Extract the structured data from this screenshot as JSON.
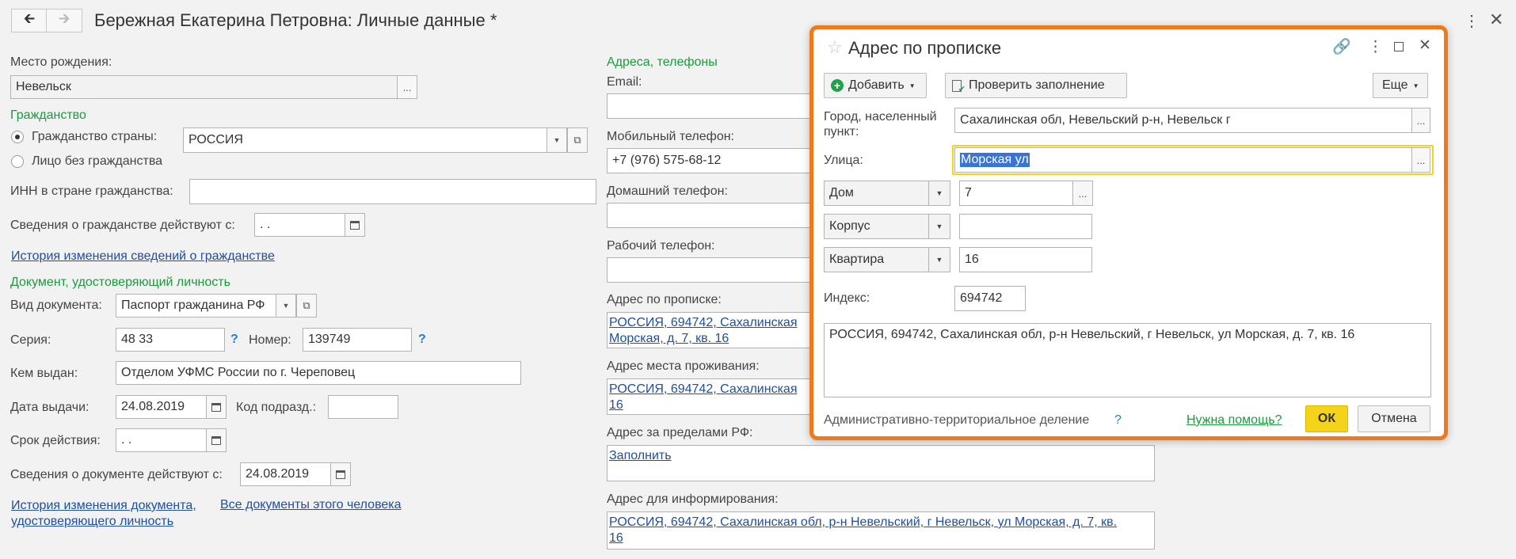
{
  "header": {
    "back_icon": "arrow-left-icon",
    "forward_icon": "arrow-right-icon",
    "title": "Бережная Екатерина Петровна: Личные данные *",
    "more_icon": "vertical-dots-icon",
    "close_icon": "close-icon"
  },
  "left": {
    "birthplace_label": "Место рождения:",
    "birthplace_value": "Невельск",
    "citizenship_section": "Гражданство",
    "radio_country_label": "Гражданство страны:",
    "country_value": "РОССИЯ",
    "radio_stateless_label": "Лицо без гражданства",
    "inn_label": "ИНН в стране гражданства:",
    "inn_value": "",
    "citizenship_valid_label": "Сведения о гражданстве действуют с:",
    "citizenship_valid_value": " .  .",
    "citizenship_history_link": "История изменения сведений о гражданстве",
    "doc_section": "Документ, удостоверяющий личность",
    "doc_type_label": "Вид документа:",
    "doc_type_value": "Паспорт гражданина РФ",
    "series_label": "Серия:",
    "series_value": "48 33",
    "number_label": "Номер:",
    "number_value": "139749",
    "issued_by_label": "Кем выдан:",
    "issued_by_value": "Отделом УФМС России по г. Череповец",
    "issue_date_label": "Дата выдачи:",
    "issue_date_value": "24.08.2019",
    "dept_code_label": "Код подразд.:",
    "dept_code_value": "",
    "expiry_label": "Срок действия:",
    "expiry_value": " .  .",
    "doc_valid_label": "Сведения о документе действуют с:",
    "doc_valid_value": "24.08.2019",
    "doc_history_link_line1": "История изменения документа,",
    "doc_history_link_line2": "удостоверяющего личность",
    "all_docs_link": "Все документы этого человека"
  },
  "right": {
    "section": "Адреса, телефоны",
    "email_label": "Email:",
    "mobile_label": "Мобильный телефон:",
    "mobile_value": "+7 (976) 575-68-12",
    "home_label": "Домашний телефон:",
    "work_label": "Рабочий телефон:",
    "reg_addr_label": "Адрес по прописке:",
    "reg_addr_line1": "РОССИЯ, 694742, Сахалинская",
    "reg_addr_line2": "Морская, д. 7, кв. 16",
    "res_addr_label": "Адрес места проживания:",
    "res_addr_line1": "РОССИЯ, 694742, Сахалинская",
    "res_addr_line2": "16",
    "foreign_addr_label": "Адрес за пределами РФ:",
    "foreign_addr_link": "Заполнить",
    "info_addr_label": "Адрес для информирования:",
    "info_addr_line1": "РОССИЯ, 694742, Сахалинская обл, р-н Невельский, г Невельск, ул Морская, д. 7, кв.",
    "info_addr_line2": "16"
  },
  "dialog": {
    "star_icon": "star-icon",
    "title": "Адрес по прописке",
    "link_icon": "link-icon",
    "more_icon": "vertical-dots-icon",
    "maximize_icon": "maximize-icon",
    "close_icon": "close-icon",
    "add_label": "Добавить",
    "check_label": "Проверить заполнение",
    "more_label": "Еще",
    "city_label_line1": "Город, населенный",
    "city_label_line2": "пункт:",
    "city_value": "Сахалинская обл, Невельский р-н, Невельск г",
    "street_label": "Улица:",
    "street_value": "Морская ул",
    "house_type": "Дом",
    "house_value": "7",
    "building_type": "Корпус",
    "building_value": "",
    "apt_type": "Квартира",
    "apt_value": "16",
    "index_label": "Индекс:",
    "index_value": "694742",
    "full_address": "РОССИЯ, 694742, Сахалинская обл, р-н Невельский, г Невельск, ул Морская, д. 7, кв. 16",
    "admin_division_label": "Административно-территориальное деление",
    "help_link": "Нужна помощь?",
    "ok_label": "ОК",
    "cancel_label": "Отмена",
    "accent_color": "#ee7a1f",
    "ok_color": "#f5d31a"
  }
}
